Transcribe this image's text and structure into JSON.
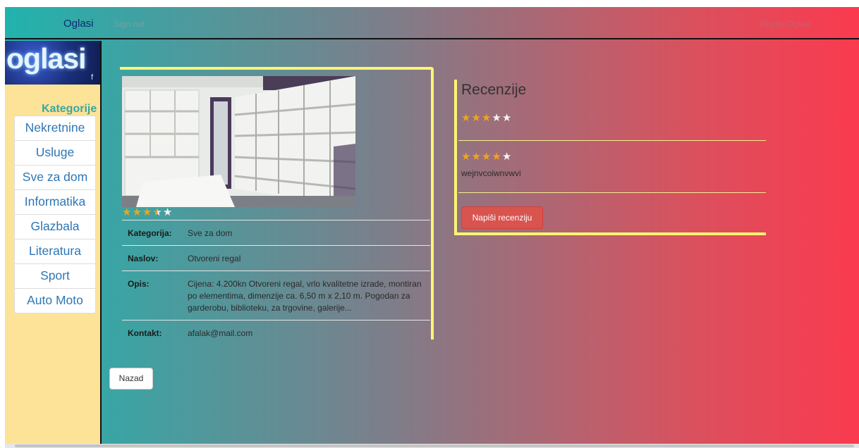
{
  "nav": {
    "brand": "Oglasi",
    "signout": "Sign out",
    "sell": "Prodaj Oglasi"
  },
  "sidebar": {
    "logo_text": "oglasi",
    "logo_mark": "f",
    "title": "Kategorije",
    "items": [
      "Nekretnine",
      "Usluge",
      "Sve za dom",
      "Informatika",
      "Glazbala",
      "Literatura",
      "Sport",
      "Auto Moto"
    ]
  },
  "ad": {
    "rating": 3.5,
    "rating_max": 5,
    "rows": [
      {
        "label": "Kategorija:",
        "value": "Sve za dom"
      },
      {
        "label": "Naslov:",
        "value": "Otvoreni regal"
      },
      {
        "label": "Opis:",
        "value": "Cijena: 4.200kn Otvoreni regal, vrlo kvalitetne izrade, montiran po elementima, dimenzije ca. 6,50 m x 2,10 m. Pogodan za garderobu, biblioteku, za trgovine, galerije..."
      },
      {
        "label": "Kontakt:",
        "value": "afalak@mail.com"
      }
    ]
  },
  "reviews": {
    "title": "Recenzije",
    "items": [
      {
        "rating": 3,
        "text": ""
      },
      {
        "rating": 4,
        "text": "wejnvcoiwnvwvi"
      }
    ],
    "write_button": "Napiši recenziju"
  },
  "back_button": "Nazad",
  "colors": {
    "gradient_left": "#21b3ae",
    "gradient_right": "#fb3a4f",
    "sidebar_bg": "#fde398",
    "accent_yellow": "#fbf572",
    "star": "#f0a419",
    "danger": "#d9534f"
  }
}
